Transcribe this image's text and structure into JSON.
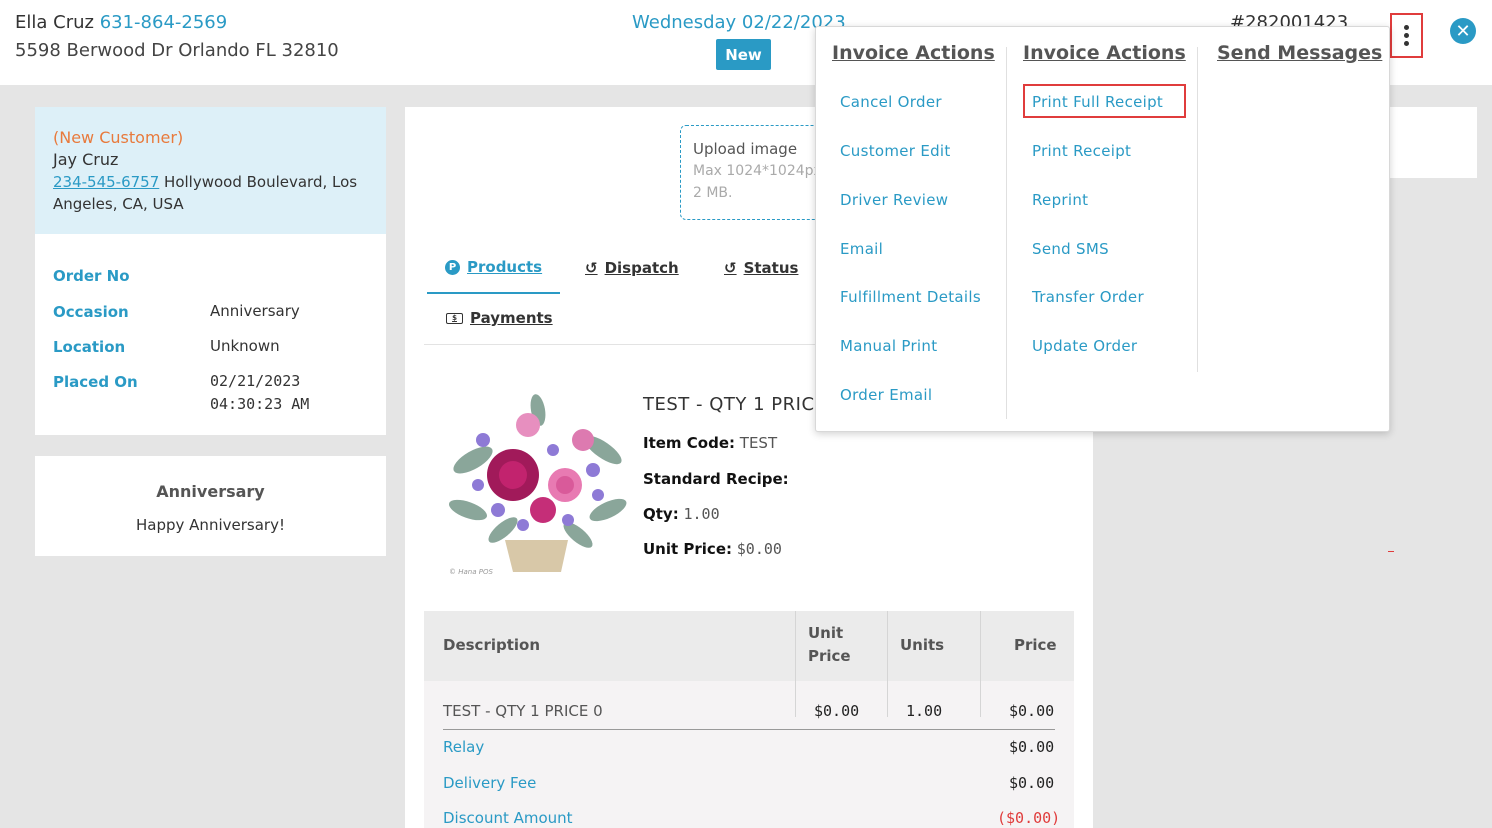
{
  "header": {
    "customer_name": "Ella Cruz",
    "customer_phone": "631-864-2569",
    "customer_address": "5598 Berwood Dr Orlando FL 32810",
    "date": "Wednesday 02/22/2023",
    "status": "New",
    "order_number": "#282001423"
  },
  "recipient": {
    "tag": "(New Customer)",
    "name": "Jay Cruz",
    "phone": "234-545-6757",
    "address": " Hollywood Boulevard, Los Angeles, CA, USA"
  },
  "details": {
    "order_no_label": "Order No",
    "occasion_label": "Occasion",
    "occasion": "Anniversary",
    "location_label": "Location",
    "location": "Unknown",
    "placed_on_label": "Placed On",
    "placed_date": "02/21/2023",
    "placed_time": "04:30:23 AM"
  },
  "card_message": {
    "title": "Anniversary",
    "text": "Happy Anniversary!"
  },
  "upload": {
    "title": "Upload image",
    "hint": "Max 1024*1024px, 2 MB."
  },
  "tabs": {
    "products": "Products",
    "dispatch": "Dispatch",
    "status": "Status",
    "payments": "Payments"
  },
  "product": {
    "title": "TEST - QTY 1 PRICE 0",
    "item_code_label": "Item Code:",
    "item_code": "TEST",
    "recipe_label": "Standard Recipe:",
    "qty_label": "Qty:",
    "qty": "1.00",
    "unit_price_label": "Unit Price:",
    "unit_price": "$0.00",
    "image_watermark": "© Hana POS"
  },
  "table": {
    "headers": {
      "description": "Description",
      "unit_price_1": "Unit",
      "unit_price_2": "Price",
      "units": "Units",
      "price": "Price"
    },
    "row": {
      "description": "TEST - QTY 1 PRICE 0",
      "unit_price": "$0.00",
      "units": "1.00",
      "price": "$0.00"
    },
    "relay_label": "Relay",
    "relay": "$0.00",
    "delivery_label": "Delivery Fee",
    "delivery": "$0.00",
    "discount_label": "Discount Amount",
    "discount": "($0.00)"
  },
  "dropdown": {
    "col1_title": "Invoice Actions",
    "col1": [
      "Cancel Order",
      "Customer Edit",
      "Driver Review",
      "Email",
      "Fulfillment Details",
      "Manual Print",
      "Order Email"
    ],
    "col2_title": "Invoice Actions",
    "col2": [
      "Print Full Receipt",
      "Print Receipt",
      "Reprint",
      "Send SMS",
      "Transfer Order",
      "Update Order"
    ],
    "col3_title": "Send Messages"
  },
  "icons": {
    "more": "kebab-vertical-icon",
    "close": "close-circle-icon",
    "products_tab": "p-circle-icon",
    "dispatch_tab": "history-icon",
    "status_tab": "history-icon",
    "payments_tab": "money-bill-icon"
  },
  "colors": {
    "accent": "#2a9ac5",
    "highlight": "#e03c3c",
    "new_customer": "#e87a3c",
    "customer_card_bg": "#ddf0f8"
  }
}
